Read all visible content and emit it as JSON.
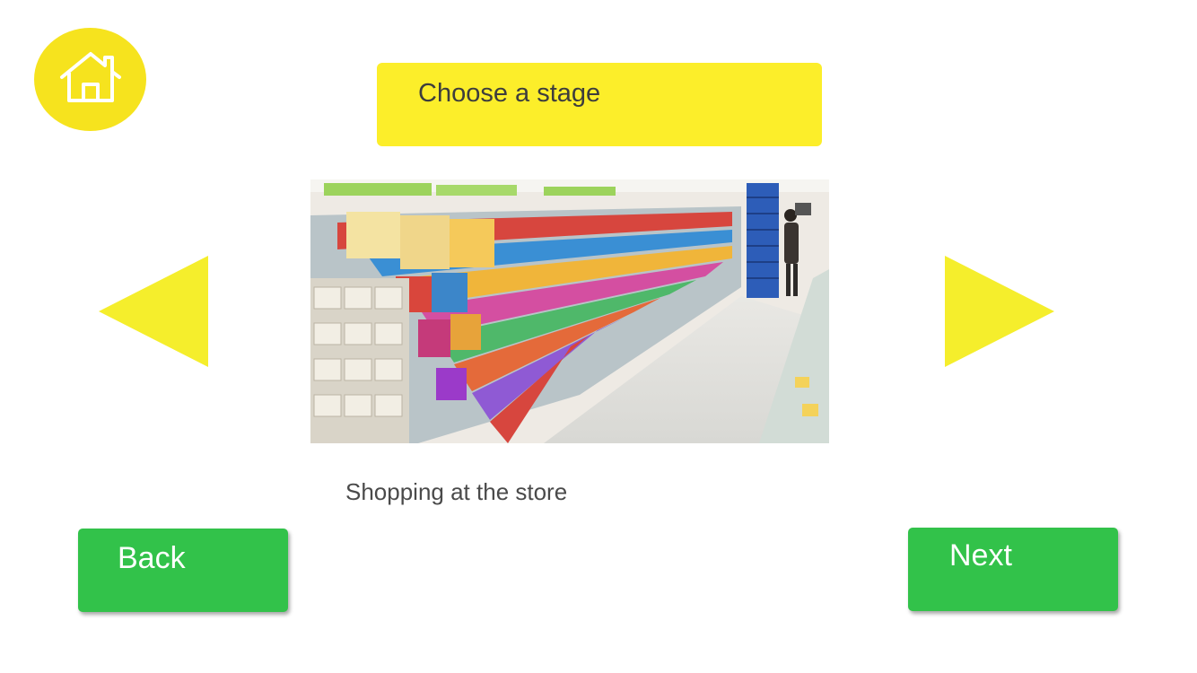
{
  "header": {
    "home_icon": "home-icon",
    "title": "Choose a stage",
    "accent_color": "#FCEE2A"
  },
  "stage": {
    "caption": "Shopping at the store",
    "image_icon": "convenience-store-aisle-photo"
  },
  "navigation": {
    "prev_icon": "triangle-left-icon",
    "next_icon": "triangle-right-icon",
    "back_label": "Back",
    "next_label": "Next",
    "button_color": "#32C24A"
  }
}
